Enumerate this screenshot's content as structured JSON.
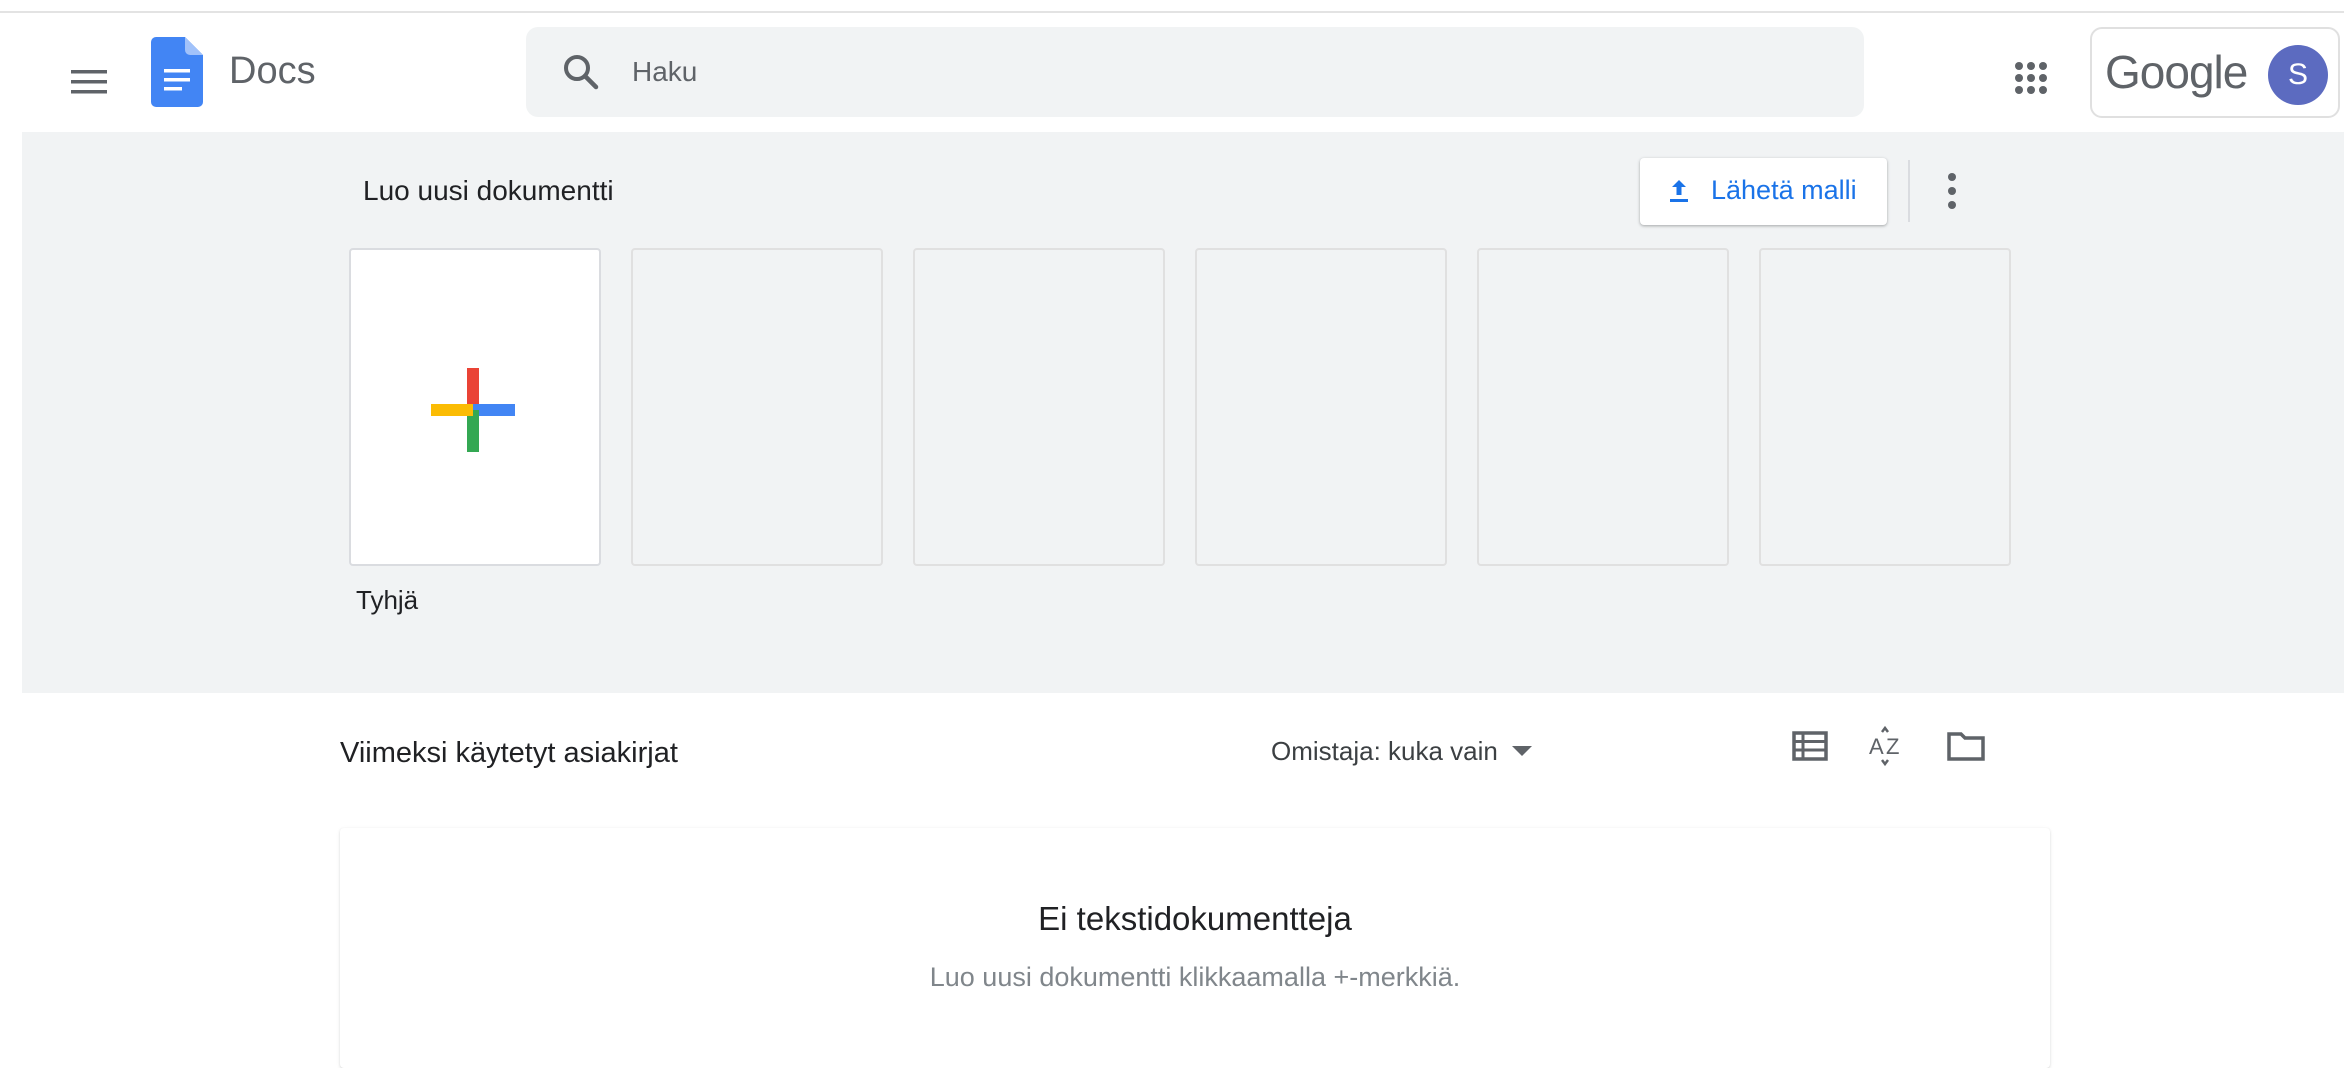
{
  "app": {
    "name": "Docs"
  },
  "search": {
    "placeholder": "Haku"
  },
  "account": {
    "brand": "Google",
    "avatar_initial": "S",
    "avatar_color": "#5c6bc0"
  },
  "templates": {
    "title": "Luo uusi dokumentti",
    "upload_label": "Lähetä malli",
    "items": [
      {
        "label": "Tyhjä"
      },
      {
        "label": ""
      },
      {
        "label": ""
      },
      {
        "label": ""
      },
      {
        "label": ""
      },
      {
        "label": ""
      }
    ]
  },
  "recent": {
    "title": "Viimeksi käytetyt asiakirjat",
    "owner_filter": "Omistaja: kuka vain",
    "empty_title": "Ei tekstidokumentteja",
    "empty_subtitle": "Luo uusi dokumentti klikkaamalla +-merkkiä."
  },
  "icons": {
    "menu": "hamburger-menu-icon",
    "logo": "docs-logo-icon",
    "search": "search-icon",
    "apps": "apps-grid-icon",
    "upload": "upload-icon",
    "more": "more-vert-icon",
    "list_view": "list-view-icon",
    "sort": "sort-az-icon",
    "folder": "folder-icon"
  },
  "colors": {
    "accent": "#1a73e8",
    "template_bg": "#f1f3f4",
    "plus_red": "#ea4335",
    "plus_blue": "#4285f4",
    "plus_green": "#34a853",
    "plus_yellow": "#fbbc04"
  }
}
